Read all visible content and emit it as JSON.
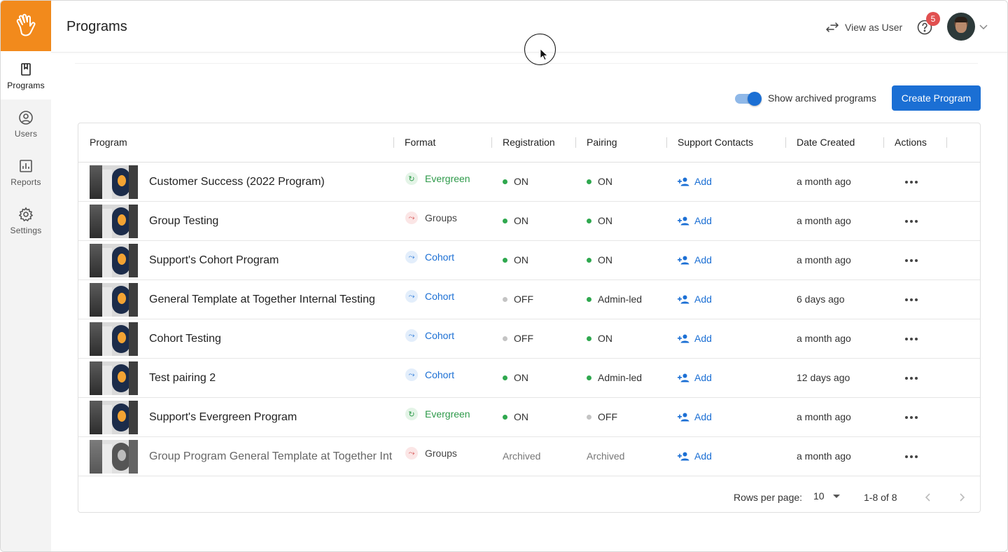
{
  "sidebar": {
    "items": [
      {
        "label": "Programs",
        "icon": "book-icon",
        "active": true
      },
      {
        "label": "Users",
        "icon": "user-circle-icon",
        "active": false
      },
      {
        "label": "Reports",
        "icon": "bar-chart-icon",
        "active": false
      },
      {
        "label": "Settings",
        "icon": "gear-icon",
        "active": false
      }
    ]
  },
  "header": {
    "title": "Programs",
    "view_as_user": "View as User",
    "help_badge_count": "5"
  },
  "toolbar": {
    "show_archived_label": "Show archived programs",
    "show_archived_on": true,
    "create_button": "Create Program"
  },
  "table": {
    "columns": [
      "Program",
      "Format",
      "Registration",
      "Pairing",
      "Support Contacts",
      "Date Created",
      "Actions"
    ],
    "rows": [
      {
        "name": "Customer Success (2022 Program)",
        "format": "Evergreen",
        "registration": "ON",
        "pairing": "ON",
        "support": "Add",
        "date": "a month ago"
      },
      {
        "name": "Group Testing",
        "format": "Groups",
        "registration": "ON",
        "pairing": "ON",
        "support": "Add",
        "date": "a month ago"
      },
      {
        "name": "Support's Cohort Program",
        "format": "Cohort",
        "registration": "ON",
        "pairing": "ON",
        "support": "Add",
        "date": "a month ago"
      },
      {
        "name": "General Template at Together Internal Testing",
        "format": "Cohort",
        "registration": "OFF",
        "pairing": "Admin-led",
        "support": "Add",
        "date": "6 days ago"
      },
      {
        "name": "Cohort Testing",
        "format": "Cohort",
        "registration": "OFF",
        "pairing": "ON",
        "support": "Add",
        "date": "a month ago"
      },
      {
        "name": "Test pairing 2",
        "format": "Cohort",
        "registration": "ON",
        "pairing": "Admin-led",
        "support": "Add",
        "date": "12 days ago"
      },
      {
        "name": "Support's Evergreen Program",
        "format": "Evergreen",
        "registration": "ON",
        "pairing": "OFF",
        "support": "Add",
        "date": "a month ago"
      },
      {
        "name": "Group Program General Template at Together Int",
        "format": "Groups",
        "registration": "Archived",
        "pairing": "Archived",
        "support": "Add",
        "date": "a month ago"
      }
    ]
  },
  "pagination": {
    "rows_per_page_label": "Rows per page:",
    "rows_per_page_value": "10",
    "range": "1-8 of 8"
  },
  "colors": {
    "brand_orange": "#f28a1c",
    "primary_blue": "#1b6fd4",
    "on_green": "#2fa84f",
    "off_gray": "#c4c4c4",
    "badge_red": "#e15050"
  }
}
